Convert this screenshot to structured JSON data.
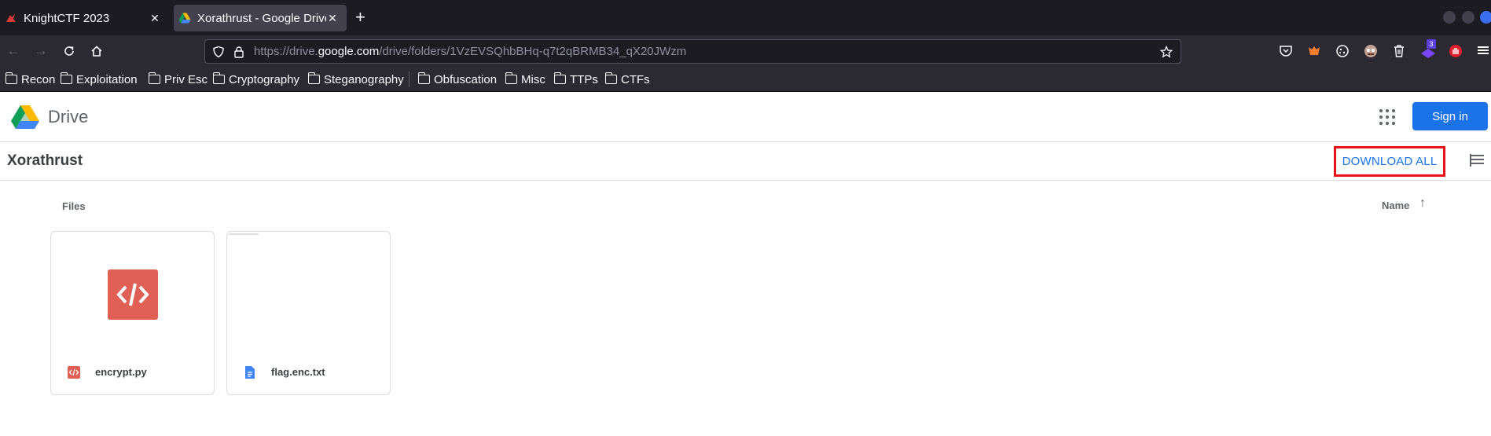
{
  "browser": {
    "tabs": [
      {
        "title": "KnightCTF 2023",
        "active": false
      },
      {
        "title": "Xorathrust - Google Drive",
        "active": true
      }
    ],
    "url": {
      "prefix": "https://drive.",
      "host": "google.com",
      "path": "/drive/folders/1VzEVSQhbBHq-q7t2qBRMB34_qX20JWzm"
    },
    "extension_badge": "3",
    "bookmarks": [
      "Recon",
      "Exploitation",
      "Priv Esc",
      "Cryptography",
      "Steganography",
      "Obfuscation",
      "Misc",
      "TTPs",
      "CTFs"
    ]
  },
  "drive": {
    "product_name": "Drive",
    "sign_in_label": "Sign in",
    "folder_name": "Xorathrust",
    "download_all_label": "DOWNLOAD ALL",
    "files_section_label": "Files",
    "sort_label": "Name",
    "files": [
      {
        "name": "encrypt.py",
        "type": "code-file-icon"
      },
      {
        "name": "flag.enc.txt",
        "type": "document-file-icon"
      }
    ]
  },
  "colors": {
    "accent": "#1a73e8",
    "highlight_box": "#e8141a",
    "code_icon": "#e06055"
  }
}
